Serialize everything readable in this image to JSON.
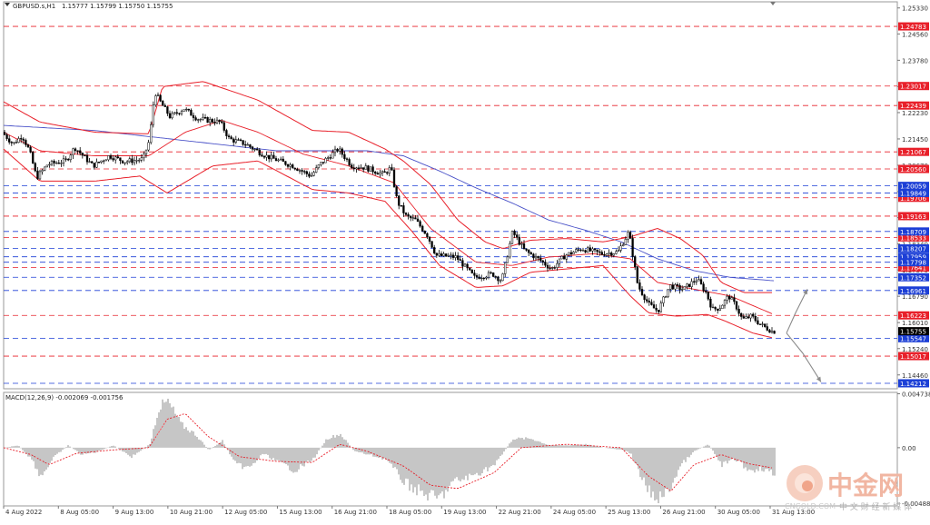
{
  "chart_data": [
    {
      "type": "candlestick",
      "header": {
        "symbol_label": "GBPUSD.s,H1",
        "ohlc": "1.15777 1.15799 1.15750 1.15755"
      },
      "ylim": [
        1.1405,
        1.2535
      ],
      "price_ticks": [
        "1.25330",
        "1.24560",
        "1.23780",
        "1.23000",
        "1.22230",
        "1.21450",
        "1.20670",
        "1.19890",
        "1.19120",
        "1.18340",
        "1.17570",
        "1.16790",
        "1.16010",
        "1.15240",
        "1.14460"
      ],
      "x_labels": [
        "4 Aug 2022",
        "8 Aug 05:00",
        "9 Aug 13:00",
        "10 Aug 21:00",
        "12 Aug 05:00",
        "15 Aug 13:00",
        "16 Aug 21:00",
        "18 Aug 05:00",
        "19 Aug 13:00",
        "22 Aug 21:00",
        "24 Aug 05:00",
        "25 Aug 13:00",
        "26 Aug 21:00",
        "30 Aug 05:00",
        "31 Aug 13:00"
      ],
      "resistance_levels": [
        {
          "label": "1.24783",
          "value": 1.24783,
          "color": "#e8202a"
        },
        {
          "label": "1.23017",
          "value": 1.23017,
          "color": "#e8202a"
        },
        {
          "label": "1.22439",
          "value": 1.22439,
          "color": "#e8202a"
        },
        {
          "label": "1.21067",
          "value": 1.21067,
          "color": "#e8202a"
        },
        {
          "label": "1.20560",
          "value": 1.2056,
          "color": "#e8202a"
        },
        {
          "label": "1.19706",
          "value": 1.19706,
          "color": "#e8202a"
        },
        {
          "label": "1.19163",
          "value": 1.19163,
          "color": "#e8202a"
        },
        {
          "label": "1.18533",
          "value": 1.18533,
          "color": "#e8202a"
        },
        {
          "label": "1.17641",
          "value": 1.17641,
          "color": "#e8202a"
        },
        {
          "label": "1.16223",
          "value": 1.16223,
          "color": "#e8202a"
        },
        {
          "label": "1.15017",
          "value": 1.15017,
          "color": "#e8202a"
        }
      ],
      "support_levels": [
        {
          "label": "1.20059",
          "value": 1.20059,
          "color": "#1c3fd6"
        },
        {
          "label": "1.19849",
          "value": 1.19849,
          "color": "#1c3fd6"
        },
        {
          "label": "1.18709",
          "value": 1.18709,
          "color": "#1c3fd6"
        },
        {
          "label": "1.18207",
          "value": 1.18207,
          "color": "#1c3fd6"
        },
        {
          "label": "1.17959",
          "value": 1.17959,
          "color": "#1c3fd6"
        },
        {
          "label": "1.17798",
          "value": 1.17798,
          "color": "#1c3fd6"
        },
        {
          "label": "1.17352",
          "value": 1.17352,
          "color": "#1c3fd6"
        },
        {
          "label": "1.16961",
          "value": 1.16961,
          "color": "#1c3fd6"
        },
        {
          "label": "1.15547",
          "value": 1.15547,
          "color": "#1c3fd6"
        },
        {
          "label": "1.14212",
          "value": 1.14212,
          "color": "#1c3fd6"
        }
      ],
      "current_price": {
        "label": "1.15755",
        "value": 1.15755
      },
      "price_anchors": [
        [
          0,
          1.2165
        ],
        [
          12,
          1.213
        ],
        [
          22,
          1.2155
        ],
        [
          30,
          1.211
        ],
        [
          38,
          1.203
        ],
        [
          50,
          1.207
        ],
        [
          70,
          1.208
        ],
        [
          80,
          1.212
        ],
        [
          100,
          1.2065
        ],
        [
          118,
          1.2095
        ],
        [
          135,
          1.2078
        ],
        [
          155,
          1.2085
        ],
        [
          162,
          1.214
        ],
        [
          168,
          1.2285
        ],
        [
          174,
          1.2255
        ],
        [
          185,
          1.221
        ],
        [
          200,
          1.2235
        ],
        [
          215,
          1.2205
        ],
        [
          240,
          1.2195
        ],
        [
          250,
          1.2145
        ],
        [
          268,
          1.213
        ],
        [
          290,
          1.2095
        ],
        [
          305,
          1.208
        ],
        [
          320,
          1.2065
        ],
        [
          340,
          1.2035
        ],
        [
          350,
          1.207
        ],
        [
          370,
          1.2115
        ],
        [
          385,
          1.2065
        ],
        [
          400,
          1.206
        ],
        [
          420,
          1.204
        ],
        [
          428,
          1.206
        ],
        [
          435,
          1.196
        ],
        [
          445,
          1.1915
        ],
        [
          455,
          1.1905
        ],
        [
          468,
          1.186
        ],
        [
          478,
          1.18
        ],
        [
          500,
          1.1795
        ],
        [
          520,
          1.1735
        ],
        [
          540,
          1.1745
        ],
        [
          550,
          1.1725
        ],
        [
          562,
          1.187
        ],
        [
          575,
          1.1815
        ],
        [
          590,
          1.179
        ],
        [
          605,
          1.176
        ],
        [
          620,
          1.18
        ],
        [
          638,
          1.182
        ],
        [
          660,
          1.1805
        ],
        [
          678,
          1.181
        ],
        [
          690,
          1.187
        ],
        [
          700,
          1.171
        ],
        [
          712,
          1.1655
        ],
        [
          722,
          1.1635
        ],
        [
          735,
          1.171
        ],
        [
          750,
          1.17
        ],
        [
          765,
          1.173
        ],
        [
          775,
          1.169
        ],
        [
          782,
          1.164
        ],
        [
          790,
          1.1645
        ],
        [
          800,
          1.168
        ],
        [
          808,
          1.165
        ],
        [
          815,
          1.161
        ],
        [
          825,
          1.162
        ],
        [
          835,
          1.1595
        ],
        [
          848,
          1.1575
        ]
      ],
      "upper_band_anchors": [
        [
          0,
          1.2255
        ],
        [
          40,
          1.2195
        ],
        [
          100,
          1.2165
        ],
        [
          160,
          1.216
        ],
        [
          175,
          1.23
        ],
        [
          220,
          1.2315
        ],
        [
          280,
          1.226
        ],
        [
          340,
          1.217
        ],
        [
          380,
          1.2165
        ],
        [
          420,
          1.2115
        ],
        [
          440,
          1.208
        ],
        [
          470,
          1.201
        ],
        [
          500,
          1.1905
        ],
        [
          530,
          1.184
        ],
        [
          550,
          1.182
        ],
        [
          580,
          1.1845
        ],
        [
          620,
          1.185
        ],
        [
          660,
          1.184
        ],
        [
          690,
          1.1855
        ],
        [
          720,
          1.188
        ],
        [
          745,
          1.185
        ],
        [
          770,
          1.18
        ],
        [
          790,
          1.172
        ],
        [
          815,
          1.169
        ],
        [
          848,
          1.169
        ]
      ],
      "lower_band_anchors": [
        [
          0,
          1.2115
        ],
        [
          40,
          1.202
        ],
        [
          100,
          1.202
        ],
        [
          150,
          1.2035
        ],
        [
          180,
          1.1985
        ],
        [
          230,
          1.2065
        ],
        [
          280,
          1.208
        ],
        [
          340,
          1.1995
        ],
        [
          380,
          1.1985
        ],
        [
          420,
          1.196
        ],
        [
          450,
          1.187
        ],
        [
          480,
          1.177
        ],
        [
          520,
          1.1705
        ],
        [
          550,
          1.171
        ],
        [
          580,
          1.175
        ],
        [
          620,
          1.176
        ],
        [
          660,
          1.177
        ],
        [
          690,
          1.168
        ],
        [
          710,
          1.163
        ],
        [
          740,
          1.162
        ],
        [
          775,
          1.1625
        ],
        [
          795,
          1.1605
        ],
        [
          825,
          1.157
        ],
        [
          848,
          1.1555
        ]
      ],
      "middle_band_anchors": [
        [
          0,
          1.2165
        ],
        [
          40,
          1.211
        ],
        [
          100,
          1.2095
        ],
        [
          160,
          1.2095
        ],
        [
          200,
          1.2165
        ],
        [
          240,
          1.22
        ],
        [
          280,
          1.2165
        ],
        [
          330,
          1.21
        ],
        [
          380,
          1.2065
        ],
        [
          430,
          1.2015
        ],
        [
          470,
          1.188
        ],
        [
          520,
          1.178
        ],
        [
          560,
          1.177
        ],
        [
          600,
          1.1795
        ],
        [
          650,
          1.1805
        ],
        [
          690,
          1.179
        ],
        [
          720,
          1.172
        ],
        [
          760,
          1.17
        ],
        [
          800,
          1.168
        ],
        [
          848,
          1.1625
        ]
      ],
      "ma_anchors": [
        [
          0,
          1.2185
        ],
        [
          100,
          1.217
        ],
        [
          200,
          1.214
        ],
        [
          300,
          1.211
        ],
        [
          400,
          1.211
        ],
        [
          440,
          1.2095
        ],
        [
          480,
          1.205
        ],
        [
          520,
          1.2
        ],
        [
          560,
          1.1955
        ],
        [
          600,
          1.1905
        ],
        [
          640,
          1.1875
        ],
        [
          680,
          1.184
        ],
        [
          720,
          1.179
        ],
        [
          760,
          1.1755
        ],
        [
          800,
          1.1735
        ],
        [
          848,
          1.1725
        ]
      ],
      "forecast": {
        "up_path": [
          [
            866,
            1.157
          ],
          [
            876,
            1.163
          ],
          [
            889,
            1.17
          ]
        ],
        "down_path": [
          [
            866,
            1.157
          ],
          [
            884,
            1.151
          ],
          [
            904,
            1.1425
          ]
        ]
      }
    },
    {
      "type": "macd",
      "label": "MACD(12,26,9) -0.002069 -0.001756",
      "ylim": [
        -0.0048,
        0.0047
      ],
      "ticks": [
        "0.004738",
        "0.00",
        "-0.004889"
      ],
      "histogram_anchors": [
        [
          0,
          0.0
        ],
        [
          15,
          0.0002
        ],
        [
          30,
          -0.001
        ],
        [
          40,
          -0.0025
        ],
        [
          55,
          -0.0008
        ],
        [
          70,
          0.0002
        ],
        [
          85,
          -0.0006
        ],
        [
          100,
          -0.0004
        ],
        [
          120,
          0.0002
        ],
        [
          140,
          -0.0008
        ],
        [
          160,
          0.0003
        ],
        [
          170,
          0.0035
        ],
        [
          180,
          0.004
        ],
        [
          195,
          0.002
        ],
        [
          210,
          0.0012
        ],
        [
          225,
          -0.0002
        ],
        [
          240,
          0.0006
        ],
        [
          255,
          -0.0015
        ],
        [
          270,
          -0.0018
        ],
        [
          285,
          -0.0005
        ],
        [
          300,
          -0.0012
        ],
        [
          320,
          -0.002
        ],
        [
          340,
          -0.001
        ],
        [
          355,
          0.0008
        ],
        [
          370,
          0.0012
        ],
        [
          385,
          -0.0003
        ],
        [
          400,
          -0.0006
        ],
        [
          420,
          -0.001
        ],
        [
          440,
          -0.003
        ],
        [
          460,
          -0.004
        ],
        [
          478,
          -0.0045
        ],
        [
          495,
          -0.003
        ],
        [
          515,
          -0.0025
        ],
        [
          540,
          -0.0015
        ],
        [
          560,
          0.0008
        ],
        [
          580,
          0.0008
        ],
        [
          600,
          0.0002
        ],
        [
          620,
          0.0002
        ],
        [
          640,
          0.0003
        ],
        [
          660,
          0.0
        ],
        [
          680,
          -0.0002
        ],
        [
          690,
          -0.0005
        ],
        [
          700,
          -0.0025
        ],
        [
          715,
          -0.0045
        ],
        [
          730,
          -0.004
        ],
        [
          745,
          -0.0015
        ],
        [
          760,
          -0.0003
        ],
        [
          775,
          0.0003
        ],
        [
          790,
          -0.0015
        ],
        [
          805,
          -0.001
        ],
        [
          820,
          -0.002
        ],
        [
          835,
          -0.0018
        ],
        [
          848,
          -0.0024
        ]
      ],
      "signal_anchors": [
        [
          0,
          0.0
        ],
        [
          30,
          -0.0006
        ],
        [
          50,
          -0.0015
        ],
        [
          80,
          -0.0005
        ],
        [
          120,
          -0.0002
        ],
        [
          160,
          0.0
        ],
        [
          180,
          0.0025
        ],
        [
          200,
          0.003
        ],
        [
          225,
          0.001
        ],
        [
          260,
          -0.0008
        ],
        [
          300,
          -0.0012
        ],
        [
          340,
          -0.0013
        ],
        [
          370,
          0.0003
        ],
        [
          400,
          -0.0003
        ],
        [
          440,
          -0.0016
        ],
        [
          470,
          -0.0033
        ],
        [
          500,
          -0.0036
        ],
        [
          540,
          -0.0022
        ],
        [
          570,
          0.0
        ],
        [
          620,
          0.0003
        ],
        [
          680,
          0.0
        ],
        [
          710,
          -0.0025
        ],
        [
          735,
          -0.0038
        ],
        [
          760,
          -0.0015
        ],
        [
          790,
          -0.0006
        ],
        [
          820,
          -0.0014
        ],
        [
          848,
          -0.0018
        ]
      ]
    }
  ],
  "watermark": {
    "brand": "中金网",
    "subtitle": "中 文 财 经 新 媒 体",
    "site": "CNGOLD.COM"
  }
}
